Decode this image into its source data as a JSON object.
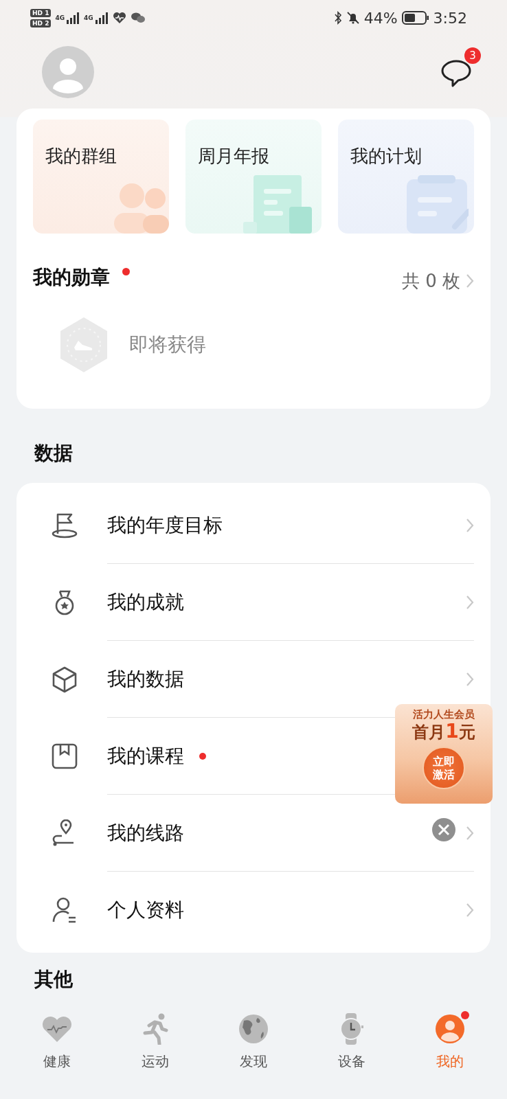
{
  "status_bar": {
    "sim_tags": [
      "HD 1",
      "HD 2"
    ],
    "network": [
      "4G",
      "4G"
    ],
    "battery": "44%",
    "time": "3:52"
  },
  "header": {
    "messages_badge": "3"
  },
  "shortcuts": [
    {
      "label": "我的群组",
      "kind": "group"
    },
    {
      "label": "周月年报",
      "kind": "report"
    },
    {
      "label": "我的计划",
      "kind": "plan"
    }
  ],
  "medals": {
    "title": "我的勋章",
    "new": true,
    "count": "共 0 枚",
    "upcoming": "即将获得"
  },
  "data_section": {
    "title": "数据",
    "items": [
      {
        "label": "我的年度目标",
        "kind": "flag",
        "new": false
      },
      {
        "label": "我的成就",
        "kind": "medal",
        "new": false
      },
      {
        "label": "我的数据",
        "kind": "cube",
        "new": false
      },
      {
        "label": "我的课程",
        "kind": "bookmark",
        "new": true
      },
      {
        "label": "我的线路",
        "kind": "route",
        "new": false
      },
      {
        "label": "个人资料",
        "kind": "person",
        "new": false
      }
    ]
  },
  "promo": {
    "title": "活力人生会员",
    "price_parts": [
      "首月",
      "1",
      "元"
    ],
    "cta": [
      "立即",
      "激活"
    ]
  },
  "other_section": {
    "title": "其他"
  },
  "nav": [
    {
      "label": "健康",
      "kind": "heart",
      "selected": false,
      "badge": false
    },
    {
      "label": "运动",
      "kind": "run",
      "selected": false,
      "badge": false
    },
    {
      "label": "发现",
      "kind": "globe",
      "selected": false,
      "badge": false
    },
    {
      "label": "设备",
      "kind": "watch",
      "selected": false,
      "badge": false
    },
    {
      "label": "我的",
      "kind": "me",
      "selected": true,
      "badge": true
    }
  ]
}
